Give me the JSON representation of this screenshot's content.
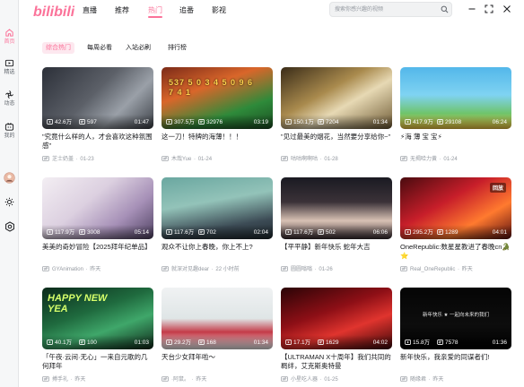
{
  "app": {
    "logo_text": "bilibili"
  },
  "sidebar": {
    "items": [
      {
        "label": "首页",
        "icon": "home-icon"
      },
      {
        "label": "精选",
        "icon": "tv-icon"
      },
      {
        "label": "动态",
        "icon": "dynamic-icon"
      },
      {
        "label": "我的",
        "icon": "my-icon"
      }
    ]
  },
  "top_tabs": [
    "直播",
    "推荐",
    "热门",
    "追番",
    "影视"
  ],
  "active_top_tab": "热门",
  "search": {
    "placeholder": "搜索你感兴趣的视频"
  },
  "sub_tabs": [
    "综合热门",
    "每周必看",
    "入站必刷",
    "排行榜"
  ],
  "active_sub_tab": "综合热门",
  "colors": {
    "accent": "#fb7299",
    "text": "#18191c",
    "muted": "#9499a0"
  },
  "videos": [
    {
      "title": "\"究竟什么样的人，才会喜欢这种氛围感\"",
      "plays": "42.6万",
      "danmaku": "597",
      "duration": "01:47",
      "author": "芝士奶盖",
      "date": "01-23"
    },
    {
      "title": "这一刀！特牌的海薄！！！",
      "plays": "307.5万",
      "danmaku": "32976",
      "duration": "03:19",
      "author": "木哉Yue",
      "date": "01-24"
    },
    {
      "title": "\"见过最美的烟花，当然要分享给你~\"",
      "plays": "150.1万",
      "danmaku": "7204",
      "duration": "01:34",
      "author": "咕咕啊啊咕",
      "date": "01-28"
    },
    {
      "title": "⚡海 薄 宝 宝⚡",
      "plays": "417.9万",
      "danmaku": "29108",
      "duration": "06:24",
      "author": "无揭哈力黄",
      "date": "01-24"
    },
    {
      "title": "美美的奇妙冒险【2025拜年纪单品】",
      "plays": "117.9万",
      "danmaku": "3008",
      "duration": "05:14",
      "author": "GYAnimation",
      "date": "昨天"
    },
    {
      "title": "观众不让你上春晚，你上不上?",
      "plays": "117.6万",
      "danmaku": "702",
      "duration": "02:04",
      "author": "就深对见趣dear",
      "date": "22 小时前"
    },
    {
      "title": "【平平静】新年快乐 蛇年大吉",
      "plays": "117.6万",
      "danmaku": "502",
      "duration": "06:06",
      "author": "圆圆嗡嗡",
      "date": "01-26"
    },
    {
      "title": "OneRepublic:数星星教进了春晚cn🐊⭐",
      "plays": "295.2万",
      "danmaku": "1289",
      "duration": "04:01",
      "author": "Real_OneRepublic",
      "date": "昨天"
    },
    {
      "title": "「午夜·云间·无心」一来自元歌的几何拜年",
      "plays": "40.1万",
      "danmaku": "100",
      "duration": "01:03",
      "author": "搏手礼",
      "date": "昨天"
    },
    {
      "title": "天台少女拜年啦～",
      "plays": "29.2万",
      "danmaku": "168",
      "duration": "01:34",
      "author": "·阿鼠。",
      "date": "昨天"
    },
    {
      "title": "【ULTRAMAN X十周年】我们共同的羁绊，艾克斯奥特曼",
      "plays": "17.1万",
      "danmaku": "1629",
      "duration": "04:02",
      "author": "小星吃人器",
      "date": "01-25"
    },
    {
      "title": "新年快乐，我亲爱的同谋者们!",
      "plays": "15.8万",
      "danmaku": "7578",
      "duration": "01:36",
      "author": "随缘君",
      "date": "昨天"
    }
  ],
  "thumb_texts": {
    "v2": "537 5 0 3 4 5 0 9 6 7 4 1",
    "v8_badge": "回放",
    "v9": "HAPPY NEW YEA",
    "v12": "新年快乐 ★ 一起向未来的我们"
  }
}
